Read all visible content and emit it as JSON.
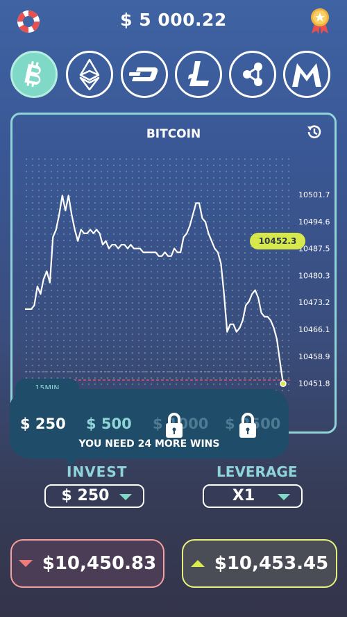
{
  "header": {
    "balance": "$ 5 000.22",
    "left_icon": "lifebuoy-icon",
    "right_icon": "medal-icon"
  },
  "coins": [
    {
      "name": "bitcoin",
      "icon": "bitcoin-icon",
      "active": true
    },
    {
      "name": "ethereum",
      "icon": "ethereum-icon",
      "active": false
    },
    {
      "name": "dash",
      "icon": "dash-icon",
      "active": false
    },
    {
      "name": "litecoin",
      "icon": "litecoin-icon",
      "active": false
    },
    {
      "name": "ripple",
      "icon": "ripple-icon",
      "active": false
    },
    {
      "name": "monero",
      "icon": "monero-icon",
      "active": false
    }
  ],
  "chart": {
    "title": "BITCOIN",
    "current_price": "10452.3",
    "y_ticks": [
      "10501.7",
      "10494.6",
      "10487.5",
      "10480.3",
      "10473.2",
      "10466.1",
      "10458.9",
      "10451.8"
    ],
    "colors": {
      "line": "#ffffff",
      "grid_dots": "#6fbcc4",
      "price_tag": "#d6e84b",
      "limit_line": "#d05a6a"
    }
  },
  "chart_data": {
    "type": "line",
    "title": "BITCOIN",
    "xlabel": "",
    "ylabel": "",
    "ylim": [
      10451.8,
      10501.7
    ],
    "y": [
      10472,
      10472,
      10472,
      10473,
      10478,
      10476,
      10480,
      10482,
      10479,
      10491,
      10493,
      10497,
      10502,
      10498,
      10502,
      10497,
      10493,
      10490,
      10493,
      10492,
      10492,
      10493,
      10492,
      10493,
      10492,
      10489,
      10490,
      10488,
      10489,
      10489,
      10488,
      10489,
      10489,
      10488,
      10489,
      10488,
      10488,
      10488,
      10487,
      10487,
      10487,
      10487,
      10487,
      10486,
      10486,
      10487,
      10486,
      10486,
      10488,
      10487,
      10487,
      10491,
      10492,
      10494,
      10497,
      10500,
      10500,
      10496,
      10495,
      10492,
      10490,
      10488,
      10487,
      10484,
      10476,
      10466,
      10468,
      10468,
      10466,
      10467,
      10469,
      10473,
      10474,
      10476,
      10477,
      10475,
      10471,
      10470,
      10470,
      10469,
      10467,
      10464,
      10458,
      10452.3
    ],
    "grid": true
  },
  "invest_popup": {
    "tab_label": "15MIN",
    "amounts": [
      {
        "label": "$ 250",
        "state": "selected"
      },
      {
        "label": "$ 500",
        "state": "available"
      },
      {
        "label": "$ 1000",
        "state": "locked"
      },
      {
        "label": "$ 2500",
        "state": "locked"
      }
    ],
    "message": "YOU NEED 24 MORE WINS"
  },
  "controls": {
    "invest_label": "INVEST",
    "invest_value": "$ 250",
    "leverage_label": "LEVERAGE",
    "leverage_value": "X1"
  },
  "trade": {
    "down_price": "$10,450.83",
    "up_price": "$10,453.45",
    "down_color": "#f07b7b",
    "up_color": "#d8ec4e"
  }
}
